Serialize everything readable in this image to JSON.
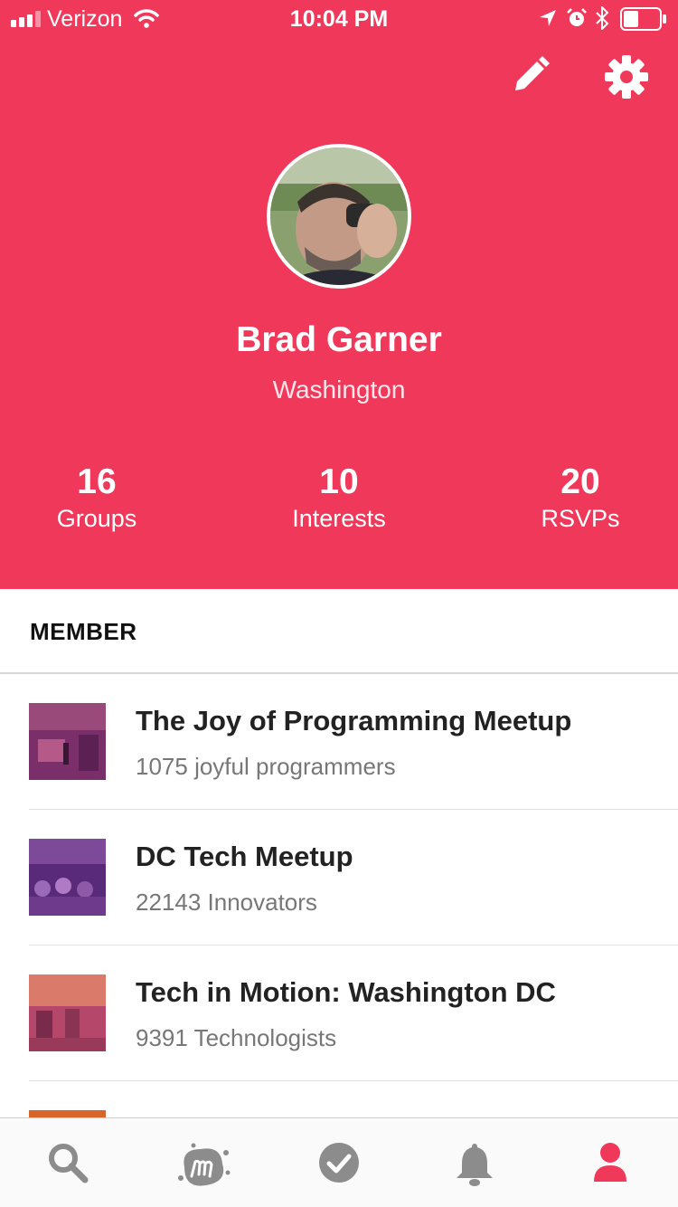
{
  "status_bar": {
    "carrier": "Verizon",
    "time": "10:04 PM",
    "icons": [
      "signal-icon",
      "wifi-icon",
      "location-icon",
      "alarm-icon",
      "bluetooth-icon",
      "battery-icon"
    ]
  },
  "header": {
    "actions": [
      "edit-icon",
      "settings-icon"
    ],
    "accent_color": "#f0395a"
  },
  "profile": {
    "name": "Brad Garner",
    "location": "Washington"
  },
  "stats": [
    {
      "value": "16",
      "label": "Groups"
    },
    {
      "value": "10",
      "label": "Interests"
    },
    {
      "value": "20",
      "label": "RSVPs"
    }
  ],
  "section": {
    "title": "MEMBER"
  },
  "groups": [
    {
      "name": "The Joy of Programming Meetup",
      "members": "1075 joyful programmers"
    },
    {
      "name": "DC Tech Meetup",
      "members": "22143 Innovators"
    },
    {
      "name": "Tech in Motion: Washington DC",
      "members": "9391 Technologists"
    }
  ],
  "tab_bar": {
    "tabs": [
      "search-icon",
      "meetup-logo-icon",
      "checkmark-icon",
      "bell-icon",
      "profile-icon"
    ],
    "active_color": "#f0395a",
    "inactive_color": "#8c8c8c"
  }
}
